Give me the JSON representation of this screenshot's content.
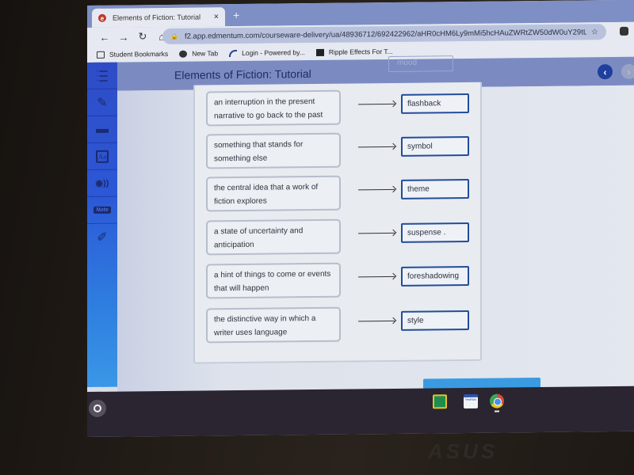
{
  "browser": {
    "tab": {
      "title": "Elements of Fiction: Tutorial",
      "favicon": "e",
      "close": "×"
    },
    "new_tab": "+",
    "nav": {
      "back": "←",
      "forward": "→",
      "reload": "↻",
      "home": "⌂"
    },
    "url": "f2.app.edmentum.com/courseware-delivery/ua/48936712/692422962/aHR0cHM6Ly9mMi5hcHAuZWRtZW50dW0uY29tL2xlYX...",
    "bookmarks": [
      {
        "label": "Student Bookmarks",
        "icon": "folder-icon"
      },
      {
        "label": "New Tab",
        "icon": "globe-icon"
      },
      {
        "label": "Login - Powered by...",
        "icon": "signal-icon"
      },
      {
        "label": "Ripple Effects For T...",
        "icon": "app-icon"
      }
    ]
  },
  "app": {
    "title": "Elements of Fiction: Tutorial",
    "ghost_term": "mood",
    "prev_button": "‹",
    "next_button": "›",
    "sidebar": [
      {
        "name": "lines-icon",
        "glyph": "≡"
      },
      {
        "name": "edit-icon",
        "glyph": "✎"
      },
      {
        "name": "folder-icon",
        "glyph": "▬"
      },
      {
        "name": "dictionary-icon",
        "glyph": "Aa"
      },
      {
        "name": "text-to-speech-icon",
        "glyph": "◉))"
      },
      {
        "name": "notes-icon",
        "glyph": "Note"
      },
      {
        "name": "highlighter-icon",
        "glyph": "✐"
      }
    ],
    "pairs": [
      {
        "definition": "an interruption in the present narrative to go back to the past",
        "term": "flashback"
      },
      {
        "definition": "something that stands for something else",
        "term": "symbol"
      },
      {
        "definition": "the central idea that a work of fiction explores",
        "term": "theme"
      },
      {
        "definition": "a state of uncertainty and anticipation",
        "term": "suspense ."
      },
      {
        "definition": "a hint of things to come or events that will happen",
        "term": "foreshadowing"
      },
      {
        "definition": "the distinctive way in which a writer uses language",
        "term": "style"
      }
    ]
  },
  "shelf": {
    "apps": [
      "Google Classroom",
      "TestNav",
      "Chrome"
    ],
    "testnav_label": "TestNav"
  },
  "device_brand": "ASUS"
}
